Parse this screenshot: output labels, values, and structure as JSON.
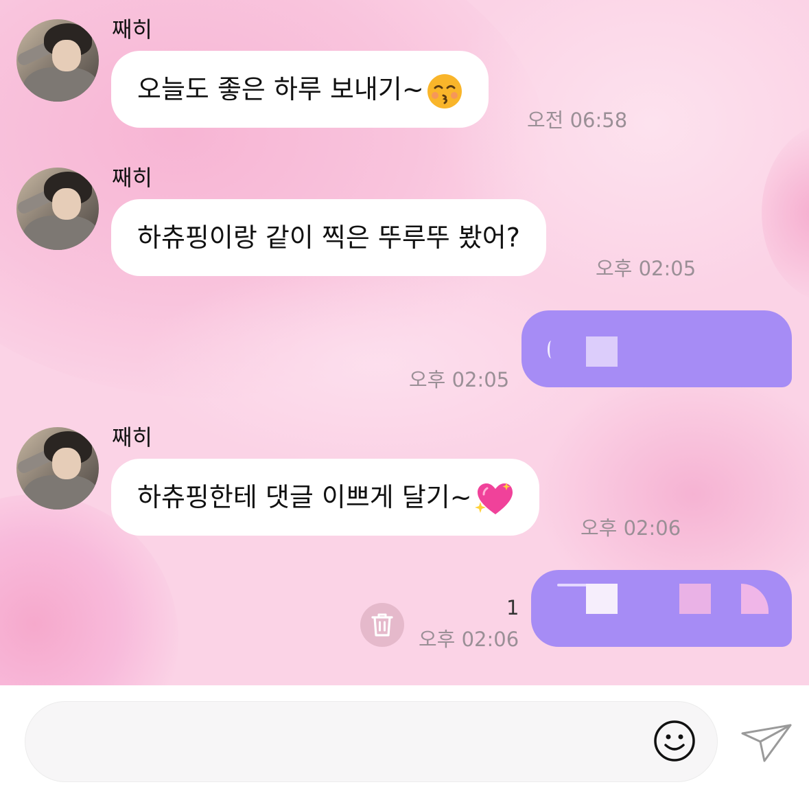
{
  "colors": {
    "chat_background": "#fbd3e6",
    "incoming_bubble": "#ffffff",
    "outgoing_bubble": "#a68cf5",
    "timestamp": "#9a8f96"
  },
  "messages": [
    {
      "direction": "incoming",
      "sender": "째히",
      "text": "오늘도 좋은 하루 보내기~",
      "emoji": "kissing-face-with-closed-eyes",
      "time": "오전 06:58"
    },
    {
      "direction": "incoming",
      "sender": "째히",
      "text": "하츄핑이랑 같이 찍은 뚜루뚜 봤어?",
      "time": "오후 02:05"
    },
    {
      "direction": "outgoing",
      "content": "redacted",
      "time": "오후 02:05"
    },
    {
      "direction": "incoming",
      "sender": "째히",
      "text": "하츄핑한테 댓글 이쁘게 달기~",
      "emoji": "sparkling-heart",
      "time": "오후 02:06"
    },
    {
      "direction": "outgoing",
      "content": "redacted",
      "time": "오후 02:06",
      "unread_count": "1"
    }
  ],
  "composer": {
    "placeholder": "",
    "emoji_icon": "smiley-face-icon",
    "send_icon": "paper-plane-icon"
  },
  "delete_icon": "trash-icon"
}
